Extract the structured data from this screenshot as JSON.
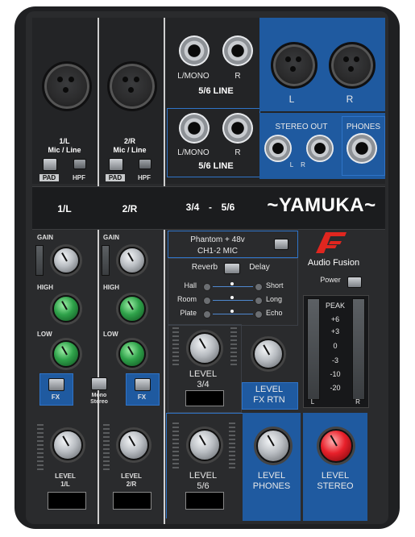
{
  "brand": {
    "name": "~YAMUKA~",
    "logo_mark": "AF",
    "logo_text": "Audio Fusion"
  },
  "top": {
    "line_56_upper": {
      "left": "L/MONO",
      "right": "R",
      "title": "5/6 LINE"
    },
    "line_56_lower": {
      "left": "L/MONO",
      "right": "R",
      "title": "5/6 LINE"
    },
    "main_out": {
      "left": "L",
      "right": "R"
    },
    "stereo_out": {
      "title": "STEREO OUT",
      "left": "L",
      "right": "R"
    },
    "phones": {
      "title": "PHONES"
    }
  },
  "ch1": {
    "name": "1/L",
    "sub": "Mic / Line",
    "pad": "PAD",
    "hpf": "HPF"
  },
  "ch2": {
    "name": "2/R",
    "sub": "Mic / Line",
    "pad": "PAD",
    "hpf": "HPF"
  },
  "band": {
    "ch1": "1/L",
    "ch2": "2/R",
    "ch34": "3/4",
    "dash": "-",
    "ch56": "5/6"
  },
  "eq": {
    "gain": "GAIN",
    "high": "HIGH",
    "low": "LOW"
  },
  "fx": {
    "label": "FX",
    "mono_stereo": "Mono Stereo"
  },
  "phantom": {
    "line1": "Phantom + 48v",
    "line2": "CH1-2 MIC"
  },
  "effects": {
    "reverb": "Reverb",
    "delay": "Delay",
    "left": [
      "Hall",
      "Room",
      "Plate"
    ],
    "right": [
      "Short",
      "Long",
      "Echo"
    ]
  },
  "power": {
    "label": "Power"
  },
  "meter": {
    "peak": "PEAK",
    "marks": [
      "+6",
      "+3",
      "0",
      "-3",
      "-10",
      "-20"
    ],
    "left": "L",
    "right": "R"
  },
  "levels": {
    "l34": {
      "a": "LEVEL",
      "b": "3/4"
    },
    "fxrtn": {
      "a": "LEVEL",
      "b": "FX RTN"
    },
    "ch1": {
      "a": "LEVEL",
      "b": "1/L"
    },
    "ch2": {
      "a": "LEVEL",
      "b": "2/R"
    },
    "l56": {
      "a": "LEVEL",
      "b": "5/6"
    },
    "phones": {
      "a": "LEVEL",
      "b": "PHONES"
    },
    "stereo": {
      "a": "LEVEL",
      "b": "STEREO"
    }
  },
  "colors": {
    "panel": "#2a2b2d",
    "accent_blue": "#1f5aa0",
    "knob_green": "#2fa24a",
    "knob_red": "#e8202a"
  }
}
